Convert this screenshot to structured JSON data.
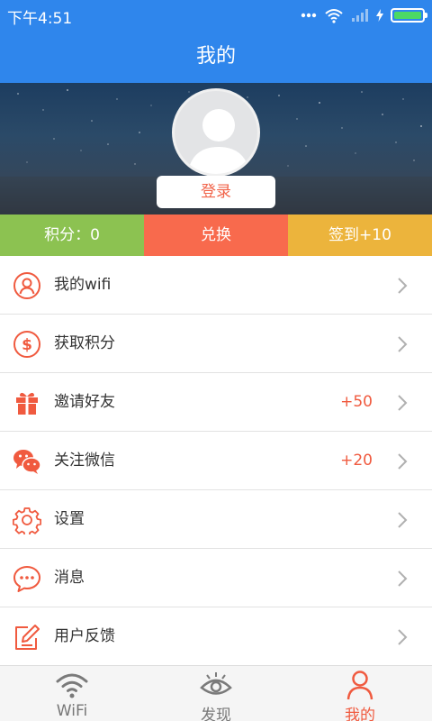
{
  "status_bar": {
    "time": "下午4:51"
  },
  "header": {
    "title": "我的"
  },
  "profile": {
    "login_label": "登录"
  },
  "stats": {
    "points_label": "积分：0",
    "redeem_label": "兑换",
    "checkin_label": "签到+10"
  },
  "menu": {
    "items": [
      {
        "label": "我的wifi",
        "badge": "",
        "icon": "user-icon"
      },
      {
        "label": "获取积分",
        "badge": "",
        "icon": "dollar-coin-icon"
      },
      {
        "label": "邀请好友",
        "badge": "+50",
        "icon": "gift-icon"
      },
      {
        "label": "关注微信",
        "badge": "+20",
        "icon": "wechat-icon"
      },
      {
        "label": "设置",
        "badge": "",
        "icon": "gear-icon"
      },
      {
        "label": "消息",
        "badge": "",
        "icon": "message-bubble-icon"
      },
      {
        "label": "用户反馈",
        "badge": "",
        "icon": "edit-feedback-icon"
      }
    ]
  },
  "tabs": [
    {
      "label": "WiFi",
      "icon": "wifi-icon",
      "active": false
    },
    {
      "label": "发现",
      "icon": "eye-icon",
      "active": false
    },
    {
      "label": "我的",
      "icon": "person-icon",
      "active": true
    }
  ],
  "colors": {
    "primary_blue": "#2f86ec",
    "accent_orange": "#f05a3f",
    "points_green": "#8cc251",
    "redeem_red": "#f86a4d",
    "checkin_yellow": "#ecb43c"
  }
}
